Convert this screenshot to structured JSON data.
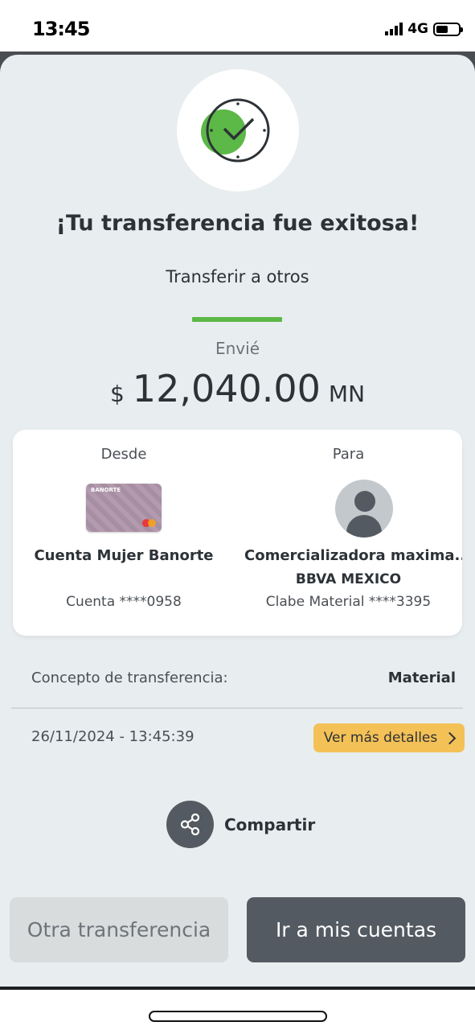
{
  "status_bar": {
    "time": "13:45",
    "network": "4G"
  },
  "receipt": {
    "title": "¡Tu transferencia fue exitosa!",
    "subtitle": "Transferir a otros",
    "sent_label": "Envié",
    "amount_currency": "$",
    "amount": "12,040.00",
    "amount_unit": "MN"
  },
  "from": {
    "heading": "Desde",
    "card_brand": "BANORTE",
    "name": "Cuenta Mujer Banorte",
    "account": "Cuenta ****0958"
  },
  "to": {
    "heading": "Para",
    "name": "Comercializadora maxima...",
    "bank": "BBVA MEXICO",
    "account": "Clabe Material ****3395"
  },
  "concept": {
    "label": "Concepto de transferencia:",
    "value": "Material"
  },
  "datetime": "26/11/2024 - 13:45:39",
  "details_button": "Ver más detalles",
  "share_label": "Compartir",
  "actions": {
    "secondary": "Otra transferencia",
    "primary": "Ir a mis cuentas"
  },
  "colors": {
    "success_green": "#5cb847",
    "accent_yellow": "#f4c157",
    "primary_button": "#545a61",
    "background": "#e8edef"
  }
}
